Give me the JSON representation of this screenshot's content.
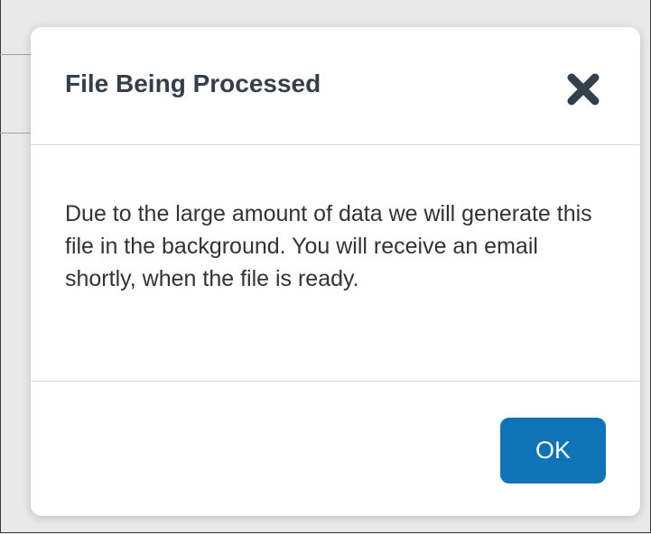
{
  "dialog": {
    "title": "File Being Processed",
    "close_icon": "close-x-icon",
    "message": "Due to the large amount of data we will generate this file in the background. You will receive an email shortly, when the file is ready.",
    "ok_label": "OK"
  },
  "colors": {
    "title_text": "#333f4a",
    "body_text": "#333333",
    "ok_button": "#0f73b8",
    "divider": "#cfd9e0",
    "backdrop": "#e9e9e9"
  }
}
